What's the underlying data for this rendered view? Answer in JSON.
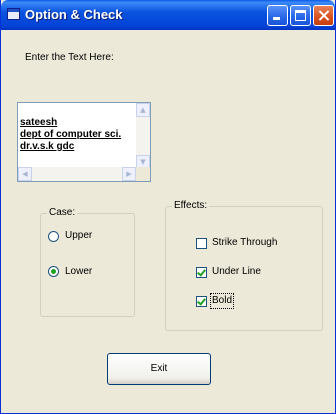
{
  "window": {
    "title": "Option & Check"
  },
  "prompt_label": "Enter the Text Here:",
  "textbox": {
    "lines": [
      "sateesh",
      "dept of computer sci.",
      "dr.v.s.k gdc"
    ]
  },
  "case_group": {
    "title": "Case:",
    "options": [
      {
        "label": "Upper",
        "selected": false
      },
      {
        "label": "Lower",
        "selected": true
      }
    ]
  },
  "effects_group": {
    "title": "Effects:",
    "options": [
      {
        "label": "Strike Through",
        "checked": false
      },
      {
        "label": "Under Line",
        "checked": true
      },
      {
        "label": "Bold",
        "checked": true
      }
    ]
  },
  "exit_button": {
    "label": "Exit"
  },
  "colors": {
    "title_bar": "#0a54e0",
    "close_button": "#d8501e",
    "check_mark": "#21a121",
    "face": "#ece9d8"
  }
}
